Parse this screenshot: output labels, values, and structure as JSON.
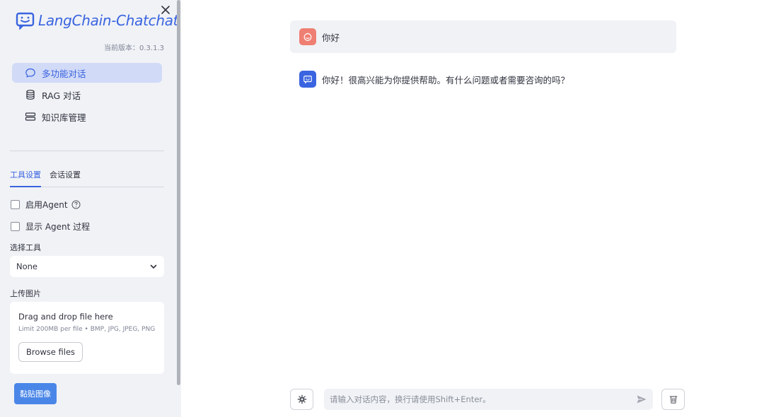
{
  "app": {
    "title": "LangChain-Chatchat",
    "version": "当前版本：0.3.1.3",
    "brand_color": "#3a64e0"
  },
  "sidebar": {
    "close_icon": "close-icon",
    "nav": [
      {
        "label": "多功能对话",
        "icon": "chat-bubble-icon",
        "active": true
      },
      {
        "label": "RAG 对话",
        "icon": "database-icon",
        "active": false
      },
      {
        "label": "知识库管理",
        "icon": "server-icon",
        "active": false
      }
    ],
    "tabs": [
      {
        "label": "工具设置",
        "active": true
      },
      {
        "label": "会话设置",
        "active": false
      }
    ],
    "checkboxes": [
      {
        "label": "启用Agent",
        "checked": false,
        "help": true
      },
      {
        "label": "显示 Agent 过程",
        "checked": false,
        "help": false
      }
    ],
    "tool_select": {
      "label": "选择工具",
      "value": "None"
    },
    "upload": {
      "label": "上传图片",
      "title": "Drag and drop file here",
      "subtitle": "Limit 200MB per file • BMP, JPG, JPEG, PNG",
      "browse_label": "Browse files"
    },
    "paste_label": "黏贴图像"
  },
  "chat": {
    "messages": [
      {
        "role": "user",
        "text": "你好",
        "avatar_color": "#ef7f73"
      },
      {
        "role": "assistant",
        "text": "你好！很高兴能为你提供帮助。有什么问题或者需要咨询的吗？",
        "avatar_color": "#3a64e0"
      }
    ],
    "input_placeholder": "请输入对话内容，换行请使用Shift+Enter。"
  }
}
